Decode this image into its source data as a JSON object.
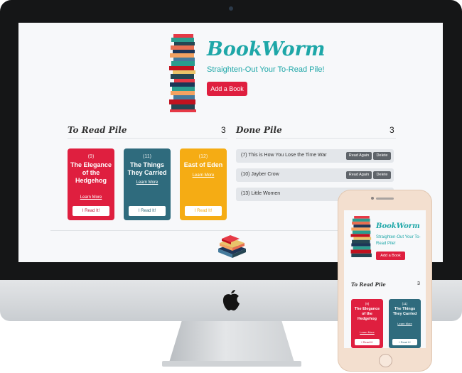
{
  "brand": {
    "name": "BookWorm",
    "tagline": "Straighten-Out Your To-Read Pile!",
    "add_button": "Add a Book",
    "teal": "#1ea7a8",
    "red": "#df1f3f"
  },
  "to_read": {
    "title": "To Read Pile",
    "count": "3",
    "books": [
      {
        "num": "(9)",
        "title": "The Elegance of the Hedgehog",
        "learn": "Learn More",
        "action": "I Read It!",
        "color": "#df1f3f"
      },
      {
        "num": "(11)",
        "title": "The Things They Carried",
        "learn": "Learn More",
        "action": "I Read It!",
        "color": "#2f6b7d"
      },
      {
        "num": "(12)",
        "title": "East of Eden",
        "learn": "Learn More",
        "action": "I Read It!",
        "color": "#f5ac14"
      }
    ]
  },
  "done": {
    "title": "Done Pile",
    "count": "3",
    "books": [
      {
        "text": "(7) This is How You Lose the Time War",
        "read_again": "Read Again",
        "delete": "Delete"
      },
      {
        "text": "(10) Jayber Crow",
        "read_again": "Read Again",
        "delete": "Delete"
      },
      {
        "text": "(13) Little Women"
      }
    ]
  },
  "icons": [
    "apple-logo-icon",
    "book-stack-icon",
    "books-icon",
    "home-button-icon"
  ]
}
